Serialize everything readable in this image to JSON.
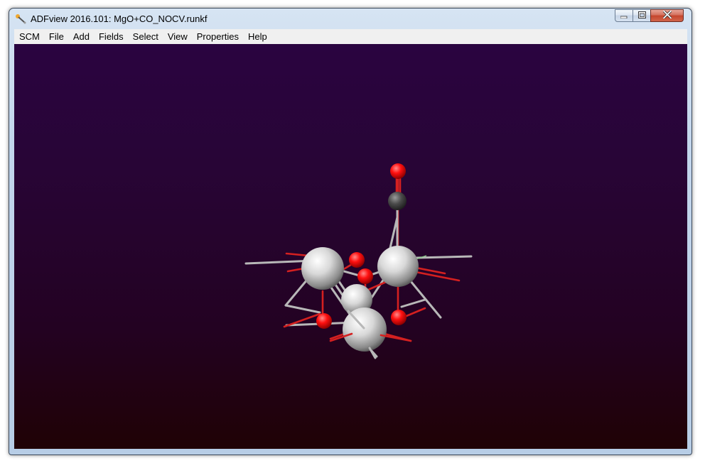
{
  "window": {
    "title": "ADFview 2016.101: MgO+CO_NOCV.runkf",
    "app_icon": "adfview-icon",
    "controls": {
      "minimize_icon": "minimize-icon",
      "maximize_icon": "maximize-icon",
      "close_icon": "close-icon"
    }
  },
  "menubar": {
    "items": [
      "SCM",
      "File",
      "Add",
      "Fields",
      "Select",
      "View",
      "Properties",
      "Help"
    ]
  },
  "viewport": {
    "content": "molecule-3d-view",
    "colors": {
      "background_top": "#2a0440",
      "background_bottom": "#200205",
      "magnesium": "#dcdcdc",
      "oxygen": "#ff0000",
      "carbon": "#3a3a3a"
    }
  }
}
